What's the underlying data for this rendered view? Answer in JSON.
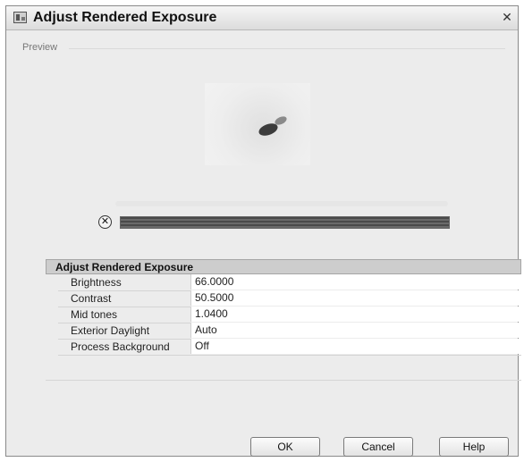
{
  "dialog": {
    "title": "Adjust Rendered Exposure"
  },
  "preview": {
    "label": "Preview"
  },
  "panel": {
    "title": "Adjust Rendered Exposure",
    "properties": [
      {
        "label": "Brightness",
        "value": "66.0000"
      },
      {
        "label": "Contrast",
        "value": "50.5000"
      },
      {
        "label": "Mid tones",
        "value": "1.0400"
      },
      {
        "label": "Exterior Daylight",
        "value": "Auto"
      },
      {
        "label": "Process Background",
        "value": "Off"
      }
    ]
  },
  "progress": {
    "fraction": 1.0
  },
  "buttons": {
    "ok": "OK",
    "cancel": "Cancel",
    "help": "Help"
  },
  "icons": {
    "window": "app-window-icon",
    "close": "close-icon",
    "cancel_render": "cancel-render-icon"
  }
}
